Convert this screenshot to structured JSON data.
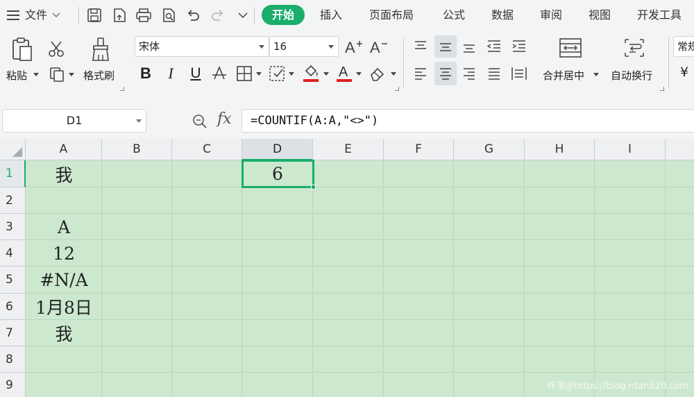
{
  "menubar": {
    "file": "文件",
    "tabs": [
      "开始",
      "插入",
      "页面布局",
      "公式",
      "数据",
      "审阅",
      "视图",
      "开发工具"
    ]
  },
  "ribbon": {
    "paste": "粘贴",
    "format_painter": "格式刷",
    "font_name": "宋体",
    "font_size": "16",
    "merge_center": "合并居中",
    "wrap_text": "自动换行",
    "number_format": "常规",
    "currency_symbol": "¥",
    "bold": "B",
    "italic": "I",
    "underline": "U",
    "font_color_letter": "A"
  },
  "formula_bar": {
    "name_box": "D1",
    "fx": "fx",
    "formula": "=COUNTIF(A:A,\"<>\")"
  },
  "grid": {
    "columns": [
      "A",
      "B",
      "C",
      "D",
      "E",
      "F",
      "G",
      "H",
      "I"
    ],
    "rows": [
      "1",
      "2",
      "3",
      "4",
      "5",
      "6",
      "7",
      "8",
      "9"
    ],
    "active_column": "D",
    "active_row": "1",
    "cells": {
      "A1": "我",
      "A3": "A",
      "A4": "12",
      "A5": "#N/A",
      "A6": "1月8日",
      "A7": "我",
      "D1": "6"
    }
  },
  "colors": {
    "accent": "#1aad6c",
    "sheet_background": "#cce8cf",
    "font_color_bar": "#e02020"
  },
  "watermark": "梓濠@https://blog.ntan520.com"
}
